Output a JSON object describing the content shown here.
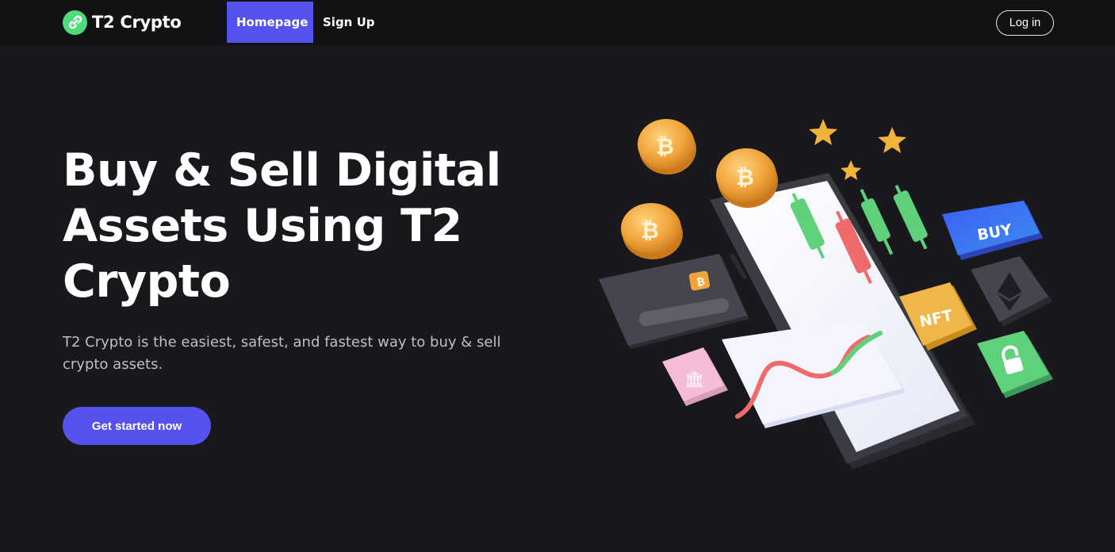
{
  "nav": {
    "brand": "T2 Crypto",
    "links": [
      {
        "label": "Homepage",
        "active": true
      },
      {
        "label": "Sign Up",
        "active": false
      }
    ],
    "login_label": "Log in"
  },
  "hero": {
    "title": "Buy & Sell Digital Assets Using T2 Crypto",
    "subtitle": "T2 Crypto is the easiest, safest, and fastest way to buy & sell crypto assets.",
    "cta_label": "Get started now"
  },
  "illustration": {
    "buy_tile": "BUY",
    "nft_tile": "NFT"
  },
  "colors": {
    "accent": "#5552ee",
    "brand_green": "#4ddb7e",
    "background": "#19181c",
    "navbar": "#121214"
  }
}
